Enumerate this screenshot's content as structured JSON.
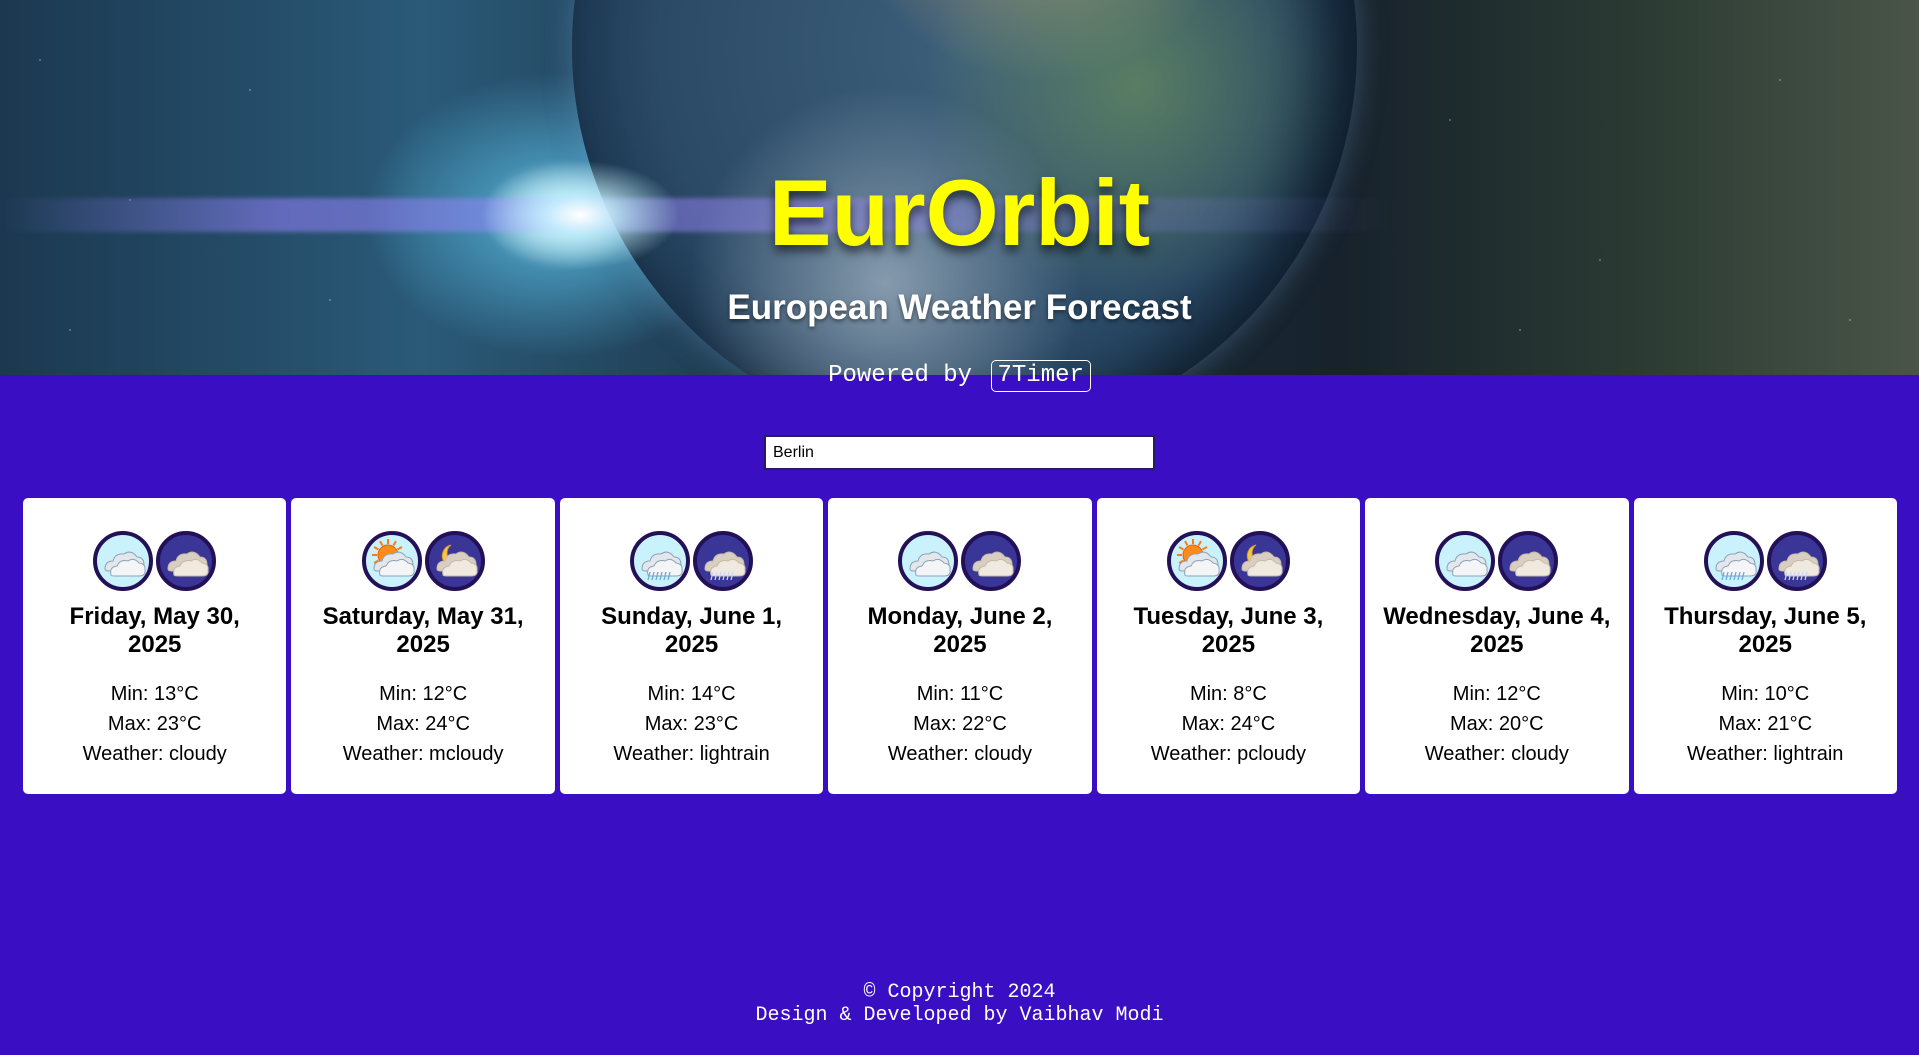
{
  "header": {
    "title": "EurOrbit",
    "subtitle": "European Weather Forecast"
  },
  "powered_by": {
    "text": "Powered by",
    "badge": "7Timer"
  },
  "search": {
    "value": "Berlin"
  },
  "forecast": [
    {
      "date": "Friday, May 30, 2025",
      "min": "Min: 13°C",
      "max": "Max: 23°C",
      "weather": "Weather: cloudy",
      "day_icon": "cloudy-day-icon",
      "night_icon": "cloudy-night-icon"
    },
    {
      "date": "Saturday, May 31, 2025",
      "min": "Min: 12°C",
      "max": "Max: 24°C",
      "weather": "Weather: mcloudy",
      "day_icon": "mostly-cloudy-day-icon",
      "night_icon": "mostly-cloudy-night-icon"
    },
    {
      "date": "Sunday, June 1, 2025",
      "min": "Min: 14°C",
      "max": "Max: 23°C",
      "weather": "Weather: lightrain",
      "day_icon": "light-rain-day-icon",
      "night_icon": "light-rain-night-icon"
    },
    {
      "date": "Monday, June 2, 2025",
      "min": "Min: 11°C",
      "max": "Max: 22°C",
      "weather": "Weather: cloudy",
      "day_icon": "cloudy-day-icon",
      "night_icon": "cloudy-night-icon"
    },
    {
      "date": "Tuesday, June 3, 2025",
      "min": "Min: 8°C",
      "max": "Max: 24°C",
      "weather": "Weather: pcloudy",
      "day_icon": "partly-cloudy-day-icon",
      "night_icon": "partly-cloudy-night-icon"
    },
    {
      "date": "Wednesday, June 4, 2025",
      "min": "Min: 12°C",
      "max": "Max: 20°C",
      "weather": "Weather: cloudy",
      "day_icon": "cloudy-day-icon",
      "night_icon": "cloudy-night-icon"
    },
    {
      "date": "Thursday, June 5, 2025",
      "min": "Min: 10°C",
      "max": "Max: 21°C",
      "weather": "Weather: lightrain",
      "day_icon": "light-rain-day-icon",
      "night_icon": "light-rain-night-icon"
    }
  ],
  "footer": {
    "copyright": "© Copyright 2024",
    "credit": "Design & Developed by Vaibhav Modi"
  },
  "colors": {
    "page_background": "#3a0fc3",
    "title": "#ffff00",
    "card_background": "#ffffff",
    "icon_border": "#241057",
    "day_icon_bg": "#c9f2fd",
    "night_icon_bg": "#3a3698"
  }
}
